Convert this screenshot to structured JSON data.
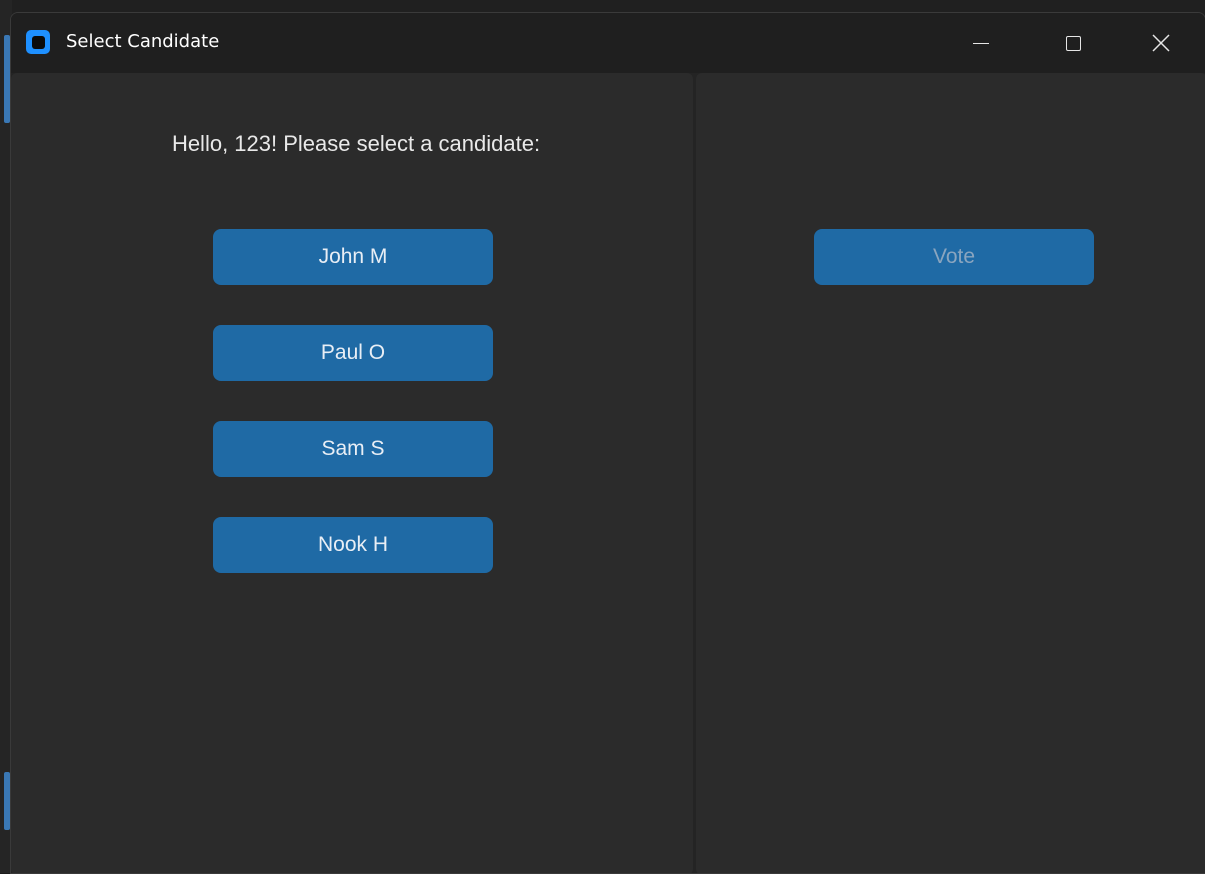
{
  "window": {
    "title": "Select Candidate",
    "icon": "app-icon",
    "controls": [
      "minimize-icon",
      "maximize-icon",
      "close-icon"
    ],
    "close_glyph": "✕"
  },
  "left_panel": {
    "greeting": "Hello, 123! Please select a candidate:",
    "candidates": [
      {
        "label": "John M"
      },
      {
        "label": "Paul O"
      },
      {
        "label": "Sam S"
      },
      {
        "label": "Nook H"
      }
    ]
  },
  "right_panel": {
    "vote_label": "Vote",
    "vote_enabled": false
  },
  "colors": {
    "accent": "#1f6aa5",
    "panel_bg": "#2b2b2b",
    "titlebar_bg": "#1f1f1f",
    "icon_blue": "#1e90ff"
  }
}
